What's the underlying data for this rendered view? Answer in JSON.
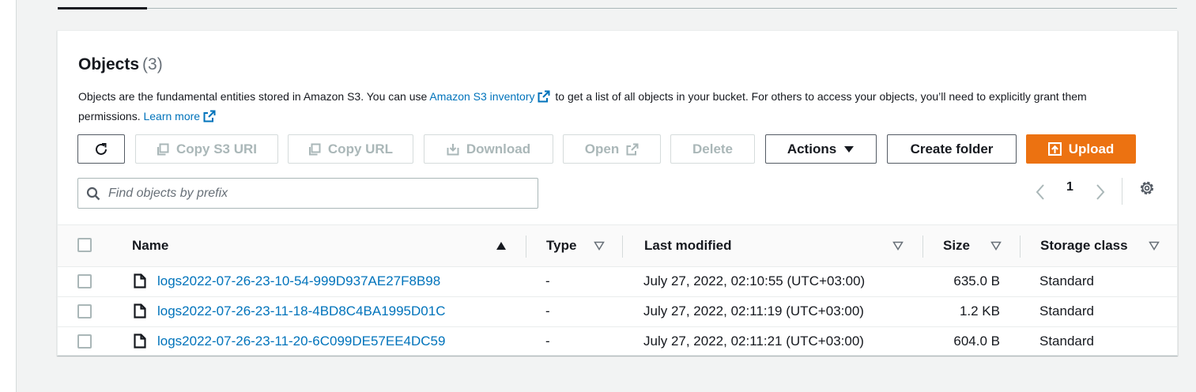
{
  "objects": {
    "title": "Objects",
    "count": "(3)",
    "desc_part1": "Objects are the fundamental entities stored in Amazon S3. You can use ",
    "inventory_link": "Amazon S3 inventory",
    "desc_part2": " to get a list of all objects in your bucket. For others to access your objects, you’ll need to explicitly grant them permissions. ",
    "learn_more": "Learn more"
  },
  "toolbar": {
    "copy_s3_uri": "Copy S3 URI",
    "copy_url": "Copy URL",
    "download": "Download",
    "open": "Open",
    "delete": "Delete",
    "actions": "Actions",
    "create_folder": "Create folder",
    "upload": "Upload"
  },
  "search": {
    "placeholder": "Find objects by prefix"
  },
  "pagination": {
    "current_page": "1"
  },
  "table": {
    "columns": {
      "name": "Name",
      "type": "Type",
      "last_modified": "Last modified",
      "size": "Size",
      "storage_class": "Storage class"
    },
    "rows": [
      {
        "name": "logs2022-07-26-23-10-54-999D937AE27F8B98",
        "type": "-",
        "last_modified": "July 27, 2022, 02:10:55 (UTC+03:00)",
        "size": "635.0 B",
        "storage_class": "Standard"
      },
      {
        "name": "logs2022-07-26-23-11-18-4BD8C4BA1995D01C",
        "type": "-",
        "last_modified": "July 27, 2022, 02:11:19 (UTC+03:00)",
        "size": "1.2 KB",
        "storage_class": "Standard"
      },
      {
        "name": "logs2022-07-26-23-11-20-6C099DE57EE4DC59",
        "type": "-",
        "last_modified": "July 27, 2022, 02:11:21 (UTC+03:00)",
        "size": "604.0 B",
        "storage_class": "Standard"
      }
    ]
  },
  "colors": {
    "link": "#0073bb",
    "primary": "#ec7211",
    "border": "#545b64",
    "disabled": "#aab7b8"
  },
  "icons": [
    "refresh-icon",
    "copy-icon",
    "download-icon",
    "external-link-icon",
    "caret-down-icon",
    "upload-icon",
    "search-icon",
    "chevron-left-icon",
    "chevron-right-icon",
    "settings-gear-icon",
    "sort-ascending-icon",
    "sort-icon",
    "file-icon"
  ]
}
